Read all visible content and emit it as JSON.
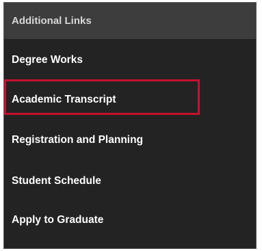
{
  "panel": {
    "header": "Additional Links",
    "links": [
      {
        "label": "Degree Works"
      },
      {
        "label": "Academic Transcript"
      },
      {
        "label": "Registration and Planning"
      },
      {
        "label": "Student Schedule"
      },
      {
        "label": "Apply to Graduate"
      }
    ],
    "highlighted_link": "Academic Transcript",
    "colors": {
      "background": "#232323",
      "header_background": "#3d3d3d",
      "highlight": "#c8102e"
    }
  }
}
